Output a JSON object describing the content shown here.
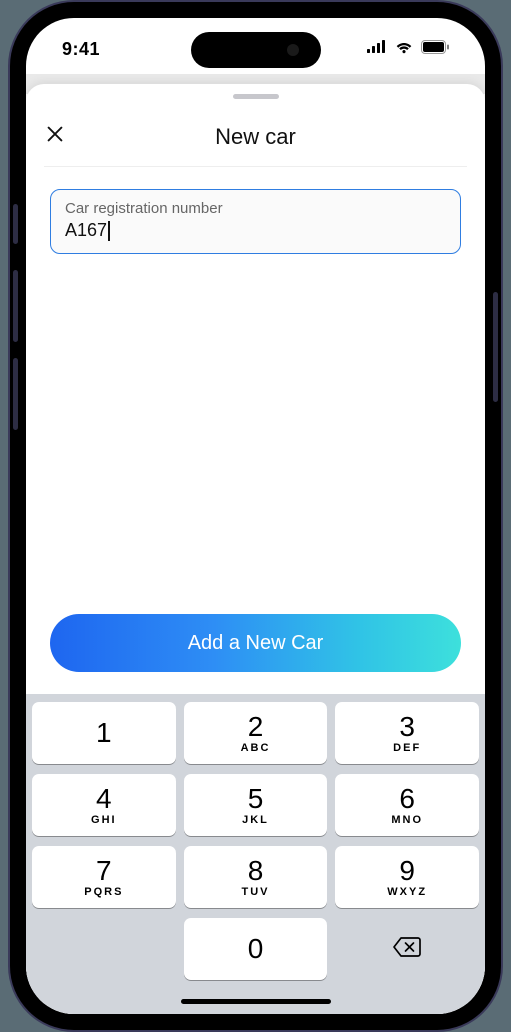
{
  "statusbar": {
    "time": "9:41"
  },
  "sheet": {
    "title": "New car",
    "field": {
      "label": "Car registration number",
      "value": "A167"
    },
    "cta": "Add a New Car"
  },
  "keypad": {
    "keys": [
      {
        "num": "1",
        "sub": ""
      },
      {
        "num": "2",
        "sub": "ABC"
      },
      {
        "num": "3",
        "sub": "DEF"
      },
      {
        "num": "4",
        "sub": "GHI"
      },
      {
        "num": "5",
        "sub": "JKL"
      },
      {
        "num": "6",
        "sub": "MNO"
      },
      {
        "num": "7",
        "sub": "PQRS"
      },
      {
        "num": "8",
        "sub": "TUV"
      },
      {
        "num": "9",
        "sub": "WXYZ"
      },
      {
        "num": "0",
        "sub": ""
      }
    ]
  }
}
